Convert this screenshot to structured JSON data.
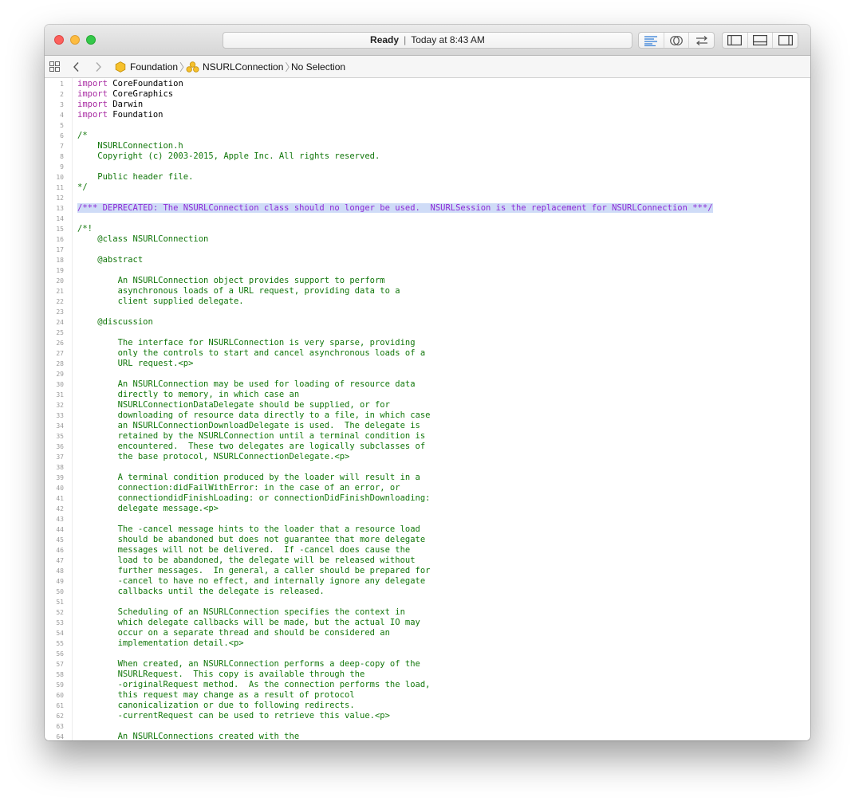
{
  "window": {
    "status": "Ready",
    "timestamp": "Today at 8:43 AM"
  },
  "jumpbar": {
    "crumbs": [
      "Foundation",
      "NSURLConnection",
      "No Selection"
    ]
  },
  "editor": {
    "lines": [
      {
        "n": "1",
        "kind": "import",
        "kw": "import",
        "text": " CoreFoundation"
      },
      {
        "n": "2",
        "kind": "import",
        "kw": "import",
        "text": " CoreGraphics"
      },
      {
        "n": "3",
        "kind": "import",
        "kw": "import",
        "text": " Darwin"
      },
      {
        "n": "4",
        "kind": "import",
        "kw": "import",
        "text": " Foundation"
      },
      {
        "n": "5",
        "kind": "comment",
        "text": ""
      },
      {
        "n": "6",
        "kind": "comment",
        "text": "/*"
      },
      {
        "n": "7",
        "kind": "comment",
        "text": "    NSURLConnection.h"
      },
      {
        "n": "8",
        "kind": "comment",
        "text": "    Copyright (c) 2003-2015, Apple Inc. All rights reserved."
      },
      {
        "n": "9",
        "kind": "comment",
        "text": ""
      },
      {
        "n": "10",
        "kind": "comment",
        "text": "    Public header file."
      },
      {
        "n": "11",
        "kind": "comment",
        "text": "*/"
      },
      {
        "n": "12",
        "kind": "comment",
        "text": ""
      },
      {
        "n": "13",
        "kind": "doc",
        "text": "/*** DEPRECATED: The NSURLConnection class should no longer be used.  NSURLSession is the replacement for NSURLConnection ***/"
      },
      {
        "n": "14",
        "kind": "comment",
        "text": ""
      },
      {
        "n": "15",
        "kind": "comment",
        "text": "/*!"
      },
      {
        "n": "16",
        "kind": "comment",
        "text": "    @class NSURLConnection"
      },
      {
        "n": "17",
        "kind": "comment",
        "text": ""
      },
      {
        "n": "18",
        "kind": "comment",
        "text": "    @abstract"
      },
      {
        "n": "19",
        "kind": "comment",
        "text": ""
      },
      {
        "n": "20",
        "kind": "comment",
        "text": "        An NSURLConnection object provides support to perform"
      },
      {
        "n": "21",
        "kind": "comment",
        "text": "        asynchronous loads of a URL request, providing data to a"
      },
      {
        "n": "22",
        "kind": "comment",
        "text": "        client supplied delegate."
      },
      {
        "n": "23",
        "kind": "comment",
        "text": ""
      },
      {
        "n": "24",
        "kind": "comment",
        "text": "    @discussion"
      },
      {
        "n": "25",
        "kind": "comment",
        "text": ""
      },
      {
        "n": "26",
        "kind": "comment",
        "text": "        The interface for NSURLConnection is very sparse, providing"
      },
      {
        "n": "27",
        "kind": "comment",
        "text": "        only the controls to start and cancel asynchronous loads of a"
      },
      {
        "n": "28",
        "kind": "comment",
        "text": "        URL request.<p>"
      },
      {
        "n": "29",
        "kind": "comment",
        "text": ""
      },
      {
        "n": "30",
        "kind": "comment",
        "text": "        An NSURLConnection may be used for loading of resource data"
      },
      {
        "n": "31",
        "kind": "comment",
        "text": "        directly to memory, in which case an"
      },
      {
        "n": "32",
        "kind": "comment",
        "text": "        NSURLConnectionDataDelegate should be supplied, or for"
      },
      {
        "n": "33",
        "kind": "comment",
        "text": "        downloading of resource data directly to a file, in which case"
      },
      {
        "n": "34",
        "kind": "comment",
        "text": "        an NSURLConnectionDownloadDelegate is used.  The delegate is"
      },
      {
        "n": "35",
        "kind": "comment",
        "text": "        retained by the NSURLConnection until a terminal condition is"
      },
      {
        "n": "36",
        "kind": "comment",
        "text": "        encountered.  These two delegates are logically subclasses of"
      },
      {
        "n": "37",
        "kind": "comment",
        "text": "        the base protocol, NSURLConnectionDelegate.<p>"
      },
      {
        "n": "38",
        "kind": "comment",
        "text": ""
      },
      {
        "n": "39",
        "kind": "comment",
        "text": "        A terminal condition produced by the loader will result in a"
      },
      {
        "n": "40",
        "kind": "comment",
        "text": "        connection:didFailWithError: in the case of an error, or"
      },
      {
        "n": "41",
        "kind": "comment",
        "text": "        connectiondidFinishLoading: or connectionDidFinishDownloading:"
      },
      {
        "n": "42",
        "kind": "comment",
        "text": "        delegate message.<p>"
      },
      {
        "n": "43",
        "kind": "comment",
        "text": ""
      },
      {
        "n": "44",
        "kind": "comment",
        "text": "        The -cancel message hints to the loader that a resource load"
      },
      {
        "n": "45",
        "kind": "comment",
        "text": "        should be abandoned but does not guarantee that more delegate"
      },
      {
        "n": "46",
        "kind": "comment",
        "text": "        messages will not be delivered.  If -cancel does cause the"
      },
      {
        "n": "47",
        "kind": "comment",
        "text": "        load to be abandoned, the delegate will be released without"
      },
      {
        "n": "48",
        "kind": "comment",
        "text": "        further messages.  In general, a caller should be prepared for"
      },
      {
        "n": "49",
        "kind": "comment",
        "text": "        -cancel to have no effect, and internally ignore any delegate"
      },
      {
        "n": "50",
        "kind": "comment",
        "text": "        callbacks until the delegate is released."
      },
      {
        "n": "51",
        "kind": "comment",
        "text": ""
      },
      {
        "n": "52",
        "kind": "comment",
        "text": "        Scheduling of an NSURLConnection specifies the context in"
      },
      {
        "n": "53",
        "kind": "comment",
        "text": "        which delegate callbacks will be made, but the actual IO may"
      },
      {
        "n": "54",
        "kind": "comment",
        "text": "        occur on a separate thread and should be considered an"
      },
      {
        "n": "55",
        "kind": "comment",
        "text": "        implementation detail.<p>"
      },
      {
        "n": "56",
        "kind": "comment",
        "text": ""
      },
      {
        "n": "57",
        "kind": "comment",
        "text": "        When created, an NSURLConnection performs a deep-copy of the"
      },
      {
        "n": "58",
        "kind": "comment",
        "text": "        NSURLRequest.  This copy is available through the"
      },
      {
        "n": "59",
        "kind": "comment",
        "text": "        -originalRequest method.  As the connection performs the load,"
      },
      {
        "n": "60",
        "kind": "comment",
        "text": "        this request may change as a result of protocol"
      },
      {
        "n": "61",
        "kind": "comment",
        "text": "        canonicalization or due to following redirects."
      },
      {
        "n": "62",
        "kind": "comment",
        "text": "        -currentRequest can be used to retrieve this value.<p>"
      },
      {
        "n": "63",
        "kind": "comment",
        "text": ""
      },
      {
        "n": "64",
        "kind": "comment",
        "text": "        An NSURLConnections created with the"
      }
    ]
  }
}
